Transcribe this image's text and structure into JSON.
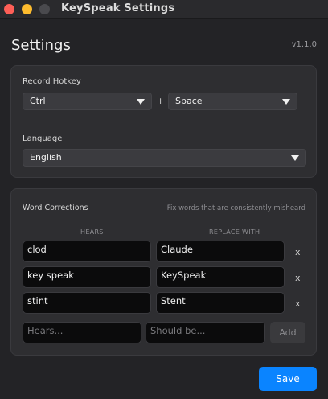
{
  "window": {
    "title": "KeySpeak Settings"
  },
  "header": {
    "title": "Settings",
    "version": "v1.1.0"
  },
  "hotkey": {
    "label": "Record Hotkey",
    "modifier": "Ctrl",
    "plus": "+",
    "key": "Space"
  },
  "language": {
    "label": "Language",
    "value": "English"
  },
  "corrections": {
    "title": "Word Corrections",
    "hint": "Fix words that are consistently misheard",
    "col_hears": "HEARS",
    "col_replace": "REPLACE WITH",
    "rows": [
      {
        "hears": "clod",
        "replace": "Claude",
        "remove": "x"
      },
      {
        "hears": "key speak",
        "replace": "KeySpeak",
        "remove": "x"
      },
      {
        "hears": "stint",
        "replace": "Stent",
        "remove": "x"
      }
    ],
    "new_hears_placeholder": "Hears...",
    "new_replace_placeholder": "Should be...",
    "add_label": "Add"
  },
  "footer": {
    "save_label": "Save"
  },
  "colors": {
    "accent": "#0a84ff",
    "close": "#fe5f57",
    "minimize": "#febc2e"
  }
}
